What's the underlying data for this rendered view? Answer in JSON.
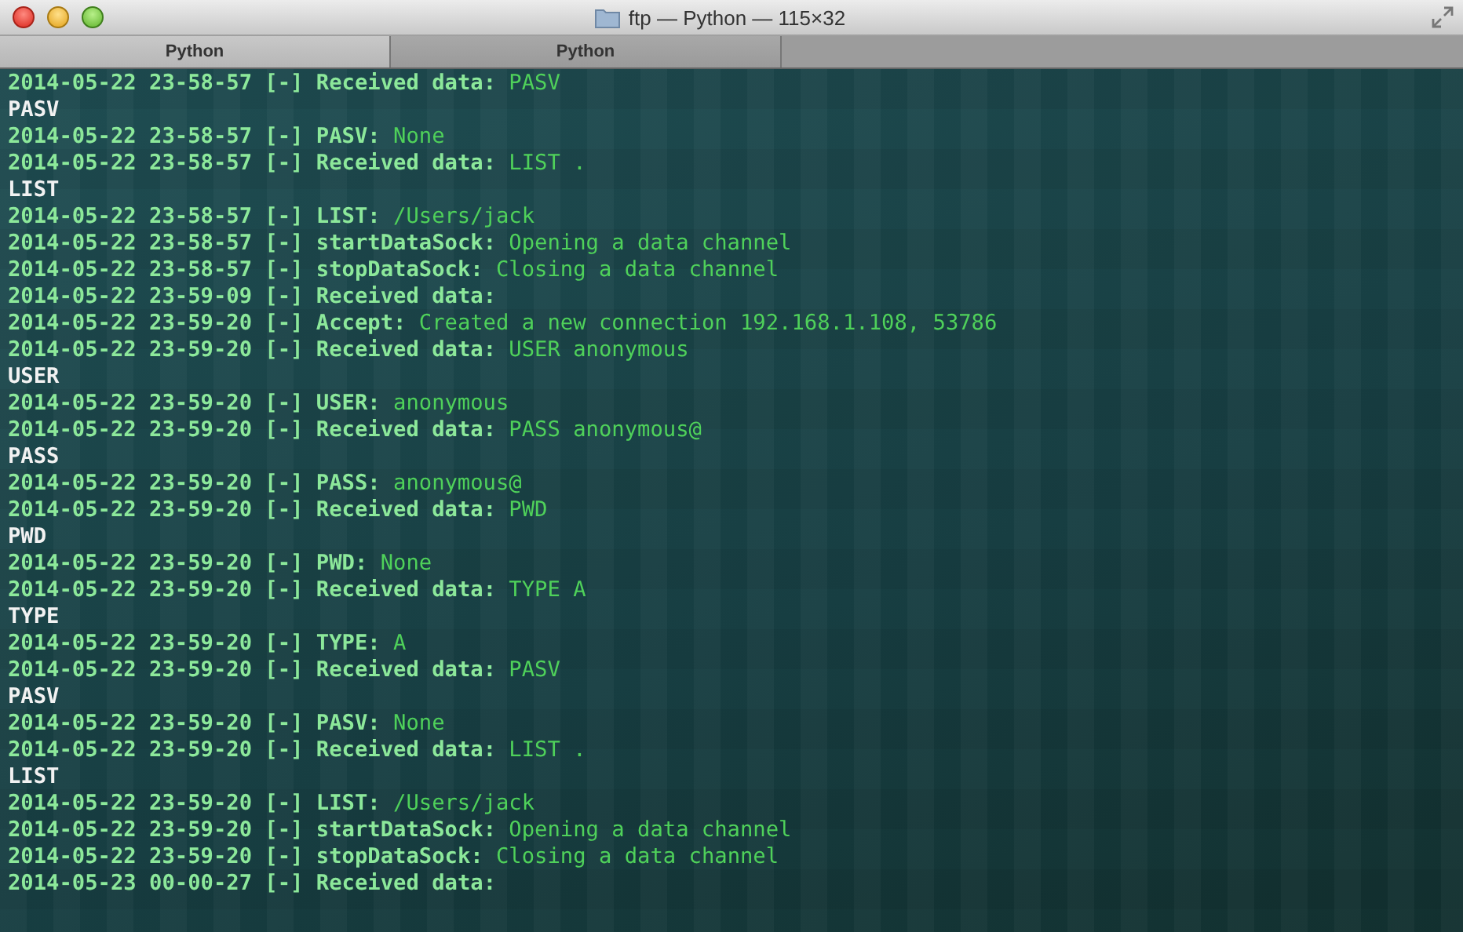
{
  "window": {
    "title": "ftp — Python — 115×32"
  },
  "tabs": [
    {
      "label": "Python",
      "selected": true
    },
    {
      "label": "Python",
      "selected": false
    }
  ],
  "lines": [
    {
      "kind": "log",
      "head": "2014-05-22 23-58-57 [-] Received data:",
      "msg": "PASV"
    },
    {
      "kind": "plain",
      "text": "PASV"
    },
    {
      "kind": "log",
      "head": "2014-05-22 23-58-57 [-] PASV:",
      "msg": "None"
    },
    {
      "kind": "log",
      "head": "2014-05-22 23-58-57 [-] Received data:",
      "msg": "LIST ."
    },
    {
      "kind": "plain",
      "text": "LIST"
    },
    {
      "kind": "log",
      "head": "2014-05-22 23-58-57 [-] LIST:",
      "msg": "/Users/jack"
    },
    {
      "kind": "log",
      "head": "2014-05-22 23-58-57 [-] startDataSock:",
      "msg": "Opening a data channel"
    },
    {
      "kind": "log",
      "head": "2014-05-22 23-58-57 [-] stopDataSock:",
      "msg": "Closing a data channel"
    },
    {
      "kind": "log",
      "head": "2014-05-22 23-59-09 [-] Received data:"
    },
    {
      "kind": "log",
      "head": "2014-05-22 23-59-20 [-] Accept:",
      "msg": "Created a new connection 192.168.1.108, 53786"
    },
    {
      "kind": "log",
      "head": "2014-05-22 23-59-20 [-] Received data:",
      "msg": "USER anonymous"
    },
    {
      "kind": "plain",
      "text": "USER"
    },
    {
      "kind": "log",
      "head": "2014-05-22 23-59-20 [-] USER:",
      "msg": "anonymous"
    },
    {
      "kind": "log",
      "head": "2014-05-22 23-59-20 [-] Received data:",
      "msg": "PASS anonymous@"
    },
    {
      "kind": "plain",
      "text": "PASS"
    },
    {
      "kind": "log",
      "head": "2014-05-22 23-59-20 [-] PASS:",
      "msg": "anonymous@"
    },
    {
      "kind": "log",
      "head": "2014-05-22 23-59-20 [-] Received data:",
      "msg": "PWD"
    },
    {
      "kind": "plain",
      "text": "PWD"
    },
    {
      "kind": "log",
      "head": "2014-05-22 23-59-20 [-] PWD:",
      "msg": "None"
    },
    {
      "kind": "log",
      "head": "2014-05-22 23-59-20 [-] Received data:",
      "msg": "TYPE A"
    },
    {
      "kind": "plain",
      "text": "TYPE"
    },
    {
      "kind": "log",
      "head": "2014-05-22 23-59-20 [-] TYPE:",
      "msg": "A"
    },
    {
      "kind": "log",
      "head": "2014-05-22 23-59-20 [-] Received data:",
      "msg": "PASV"
    },
    {
      "kind": "plain",
      "text": "PASV"
    },
    {
      "kind": "log",
      "head": "2014-05-22 23-59-20 [-] PASV:",
      "msg": "None"
    },
    {
      "kind": "log",
      "head": "2014-05-22 23-59-20 [-] Received data:",
      "msg": "LIST ."
    },
    {
      "kind": "plain",
      "text": "LIST"
    },
    {
      "kind": "log",
      "head": "2014-05-22 23-59-20 [-] LIST:",
      "msg": "/Users/jack"
    },
    {
      "kind": "log",
      "head": "2014-05-22 23-59-20 [-] startDataSock:",
      "msg": "Opening a data channel"
    },
    {
      "kind": "log",
      "head": "2014-05-22 23-59-20 [-] stopDataSock:",
      "msg": "Closing a data channel"
    },
    {
      "kind": "log",
      "head": "2014-05-23 00-00-27 [-] Received data:"
    }
  ]
}
